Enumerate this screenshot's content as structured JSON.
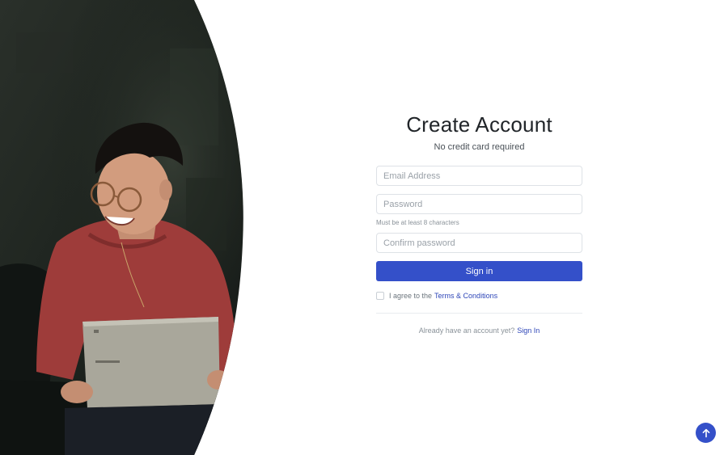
{
  "form": {
    "title": "Create Account",
    "subtitle": "No credit card required",
    "email_placeholder": "Email Address",
    "password_placeholder": "Password",
    "password_hint": "Must be at least 8 characters",
    "confirm_placeholder": "Confirm password",
    "submit_label": "Sign in",
    "agree_prefix": "I agree to the",
    "terms_link": "Terms & Conditions",
    "already_text": "Already have an account yet?",
    "signin_link": "Sign In"
  },
  "hero": {
    "image_subject": "smiling person with laptop on sofa"
  },
  "icons": {
    "back_to_top": "arrow-up-icon"
  },
  "colors": {
    "accent": "#3450c9",
    "link": "#2e46b8",
    "sweater": "#9e3c3a",
    "background_dark": "#1f2620"
  }
}
